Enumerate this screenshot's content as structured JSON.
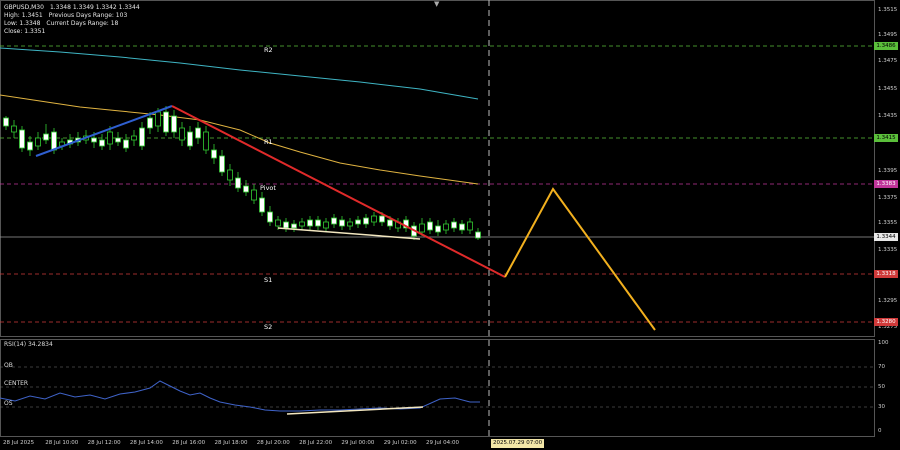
{
  "header": {
    "symbol": "GBPUSD,M30",
    "ohlc": "1.3348 1.3349 1.3342 1.3344",
    "high_label": "High: 1.3451",
    "prev_range": "Previous Days Range: 103",
    "low_label": "Low: 1.3348",
    "curr_range": "Current Days Range: 18",
    "close_label": "Close: 1.3351"
  },
  "levels": {
    "r2": "R2",
    "r1": "R1",
    "pivot": "Pivot",
    "s1": "S1",
    "s2": "S2"
  },
  "price_tags": {
    "r2": "1.3486",
    "r1": "1.3415",
    "pivot": "1.3383",
    "current": "1.3344",
    "s1": "1.3318",
    "s2": "1.3280"
  },
  "price_axis": [
    "1.3515",
    "1.3495",
    "1.3475",
    "1.3455",
    "1.3435",
    "1.3395",
    "1.3375",
    "1.3355",
    "1.3335",
    "1.3295",
    "1.3275"
  ],
  "time_axis": [
    "28 Jul 2025",
    "28 Jul 10:00",
    "28 Jul 12:00",
    "28 Jul 14:00",
    "28 Jul 16:00",
    "28 Jul 18:00",
    "28 Jul 20:00",
    "28 Jul 22:00",
    "29 Jul 00:00",
    "29 Jul 02:00",
    "29 Jul 04:00"
  ],
  "current_time": "2025.07.29 07:00",
  "rsi": {
    "label": "RSI(14) 34.2834",
    "ob": "OB",
    "center": "CENTER",
    "os": "OS",
    "axis": [
      "100",
      "70",
      "50",
      "30",
      "0"
    ]
  },
  "colors": {
    "bull_candle": "#ffffff",
    "bear_candle": "#000000",
    "wick": "#33cc33",
    "ma_fast": "#e0b341",
    "ma_slow": "#3fb5c4",
    "trend_up": "#2f5fd0",
    "trend_down": "#e02a2a",
    "projection": "#f2b01e",
    "r_line": "#5bbf3b",
    "pivot_line": "#c0359a",
    "s_line": "#d03a3a",
    "rsi_line": "#3f63c9"
  }
}
